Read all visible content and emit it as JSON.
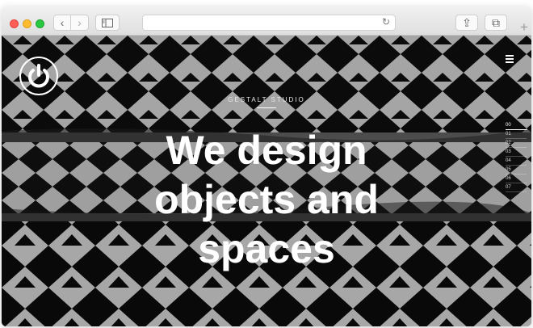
{
  "window": {
    "type": "browser"
  },
  "toolbar": {
    "back_icon": "chevron-left-icon",
    "forward_icon": "chevron-right-icon",
    "sidebar_icon": "sidebar-icon",
    "address_value": "",
    "reload_icon": "reload-icon",
    "share_icon": "share-icon",
    "tabs_icon": "tabs-overview-icon",
    "new_tab_icon": "plus-icon",
    "back_glyph": "‹",
    "forward_glyph": "›",
    "reload_glyph": "↻",
    "share_glyph": "⇪",
    "tabs_glyph": "⧉",
    "new_tab_glyph": "+"
  },
  "site": {
    "logo_icon": "power-icon",
    "menu_icon": "hamburger-menu-icon",
    "studio_name": "GESTALT STUDIO",
    "headline": [
      "We design",
      "objects and",
      "spaces"
    ],
    "pager": [
      "00",
      "01",
      "02",
      "03",
      "04",
      "05",
      "06",
      "07"
    ],
    "pager_active_index": 0
  },
  "colors": {
    "close": "#ff5f57",
    "minimize": "#febc2e",
    "zoom": "#28c840",
    "text": "#ffffff"
  }
}
